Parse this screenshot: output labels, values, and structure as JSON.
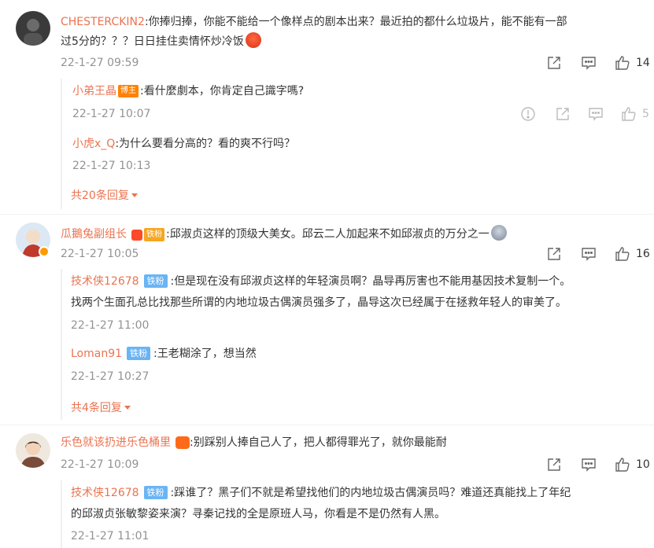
{
  "comments": [
    {
      "user": "CHESTERCKIN2",
      "text_line1": ":你捧归捧，你能不能给一个像样点的剧本出来？最近拍的都什么垃圾片，能不能有一部",
      "text_line2": "过5分的？？？日日挂住卖情怀炒冷饭",
      "time": "22-1-27 09:59",
      "likes": "14",
      "replies": [
        {
          "user": "小弟王晶",
          "badge": "博主",
          "text": ":看什麼劇本，你肯定自己識字嗎?",
          "time": "22-1-27 10:07",
          "likes": "5"
        },
        {
          "user": "小虎x_Q",
          "text": ":为什么要看分高的？看的爽不行吗？",
          "time": "22-1-27 10:13"
        }
      ],
      "more_replies": "共20条回复"
    },
    {
      "user": "瓜鵝兔副组长",
      "badge": "铁粉",
      "text": ":邱淑贞这样的顶级大美女。邱云二人加起来不如邱淑贞的万分之一",
      "time": "22-1-27 10:05",
      "likes": "16",
      "replies": [
        {
          "user": "技术侠12678",
          "badge": "铁粉",
          "text_line1": ":但是现在没有邱淑贞这样的年轻演员啊？晶导再厉害也不能用基因技术复制一个。",
          "text_line2": "找两个生面孔总比找那些所谓的内地垃圾古偶演员强多了，晶导这次已经属于在拯救年轻人的审美了。",
          "time": "22-1-27 11:00"
        },
        {
          "user": "Loman91",
          "badge": "铁粉",
          "text": ":王老糊涂了，想当然",
          "time": "22-1-27 10:27"
        }
      ],
      "more_replies": "共4条回复"
    },
    {
      "user": "乐色就该扔进乐色桶里",
      "text": ":别踩别人捧自己人了，把人都得罪光了，就你最能耐",
      "time": "22-1-27 10:09",
      "likes": "10",
      "replies": [
        {
          "user": "技术侠12678",
          "badge": "铁粉",
          "text_line1": ":踩谁了？黑子们不就是希望找他们的内地垃圾古偶演员吗？难道还真能找上了年纪",
          "text_line2": "的邱淑贞张敏黎姿来演？寻秦记找的全是原班人马，你看是不是仍然有人黑。",
          "time": "22-1-27 11:01"
        }
      ]
    }
  ],
  "icons": {
    "share": "share-icon",
    "comment": "comment-icon",
    "like": "thumbs-up-icon",
    "report": "report-icon"
  },
  "colors": {
    "username": "#eb7350",
    "time": "#939393",
    "fan_badge": "#6ab4f4",
    "author_badge": "#ff8200"
  }
}
